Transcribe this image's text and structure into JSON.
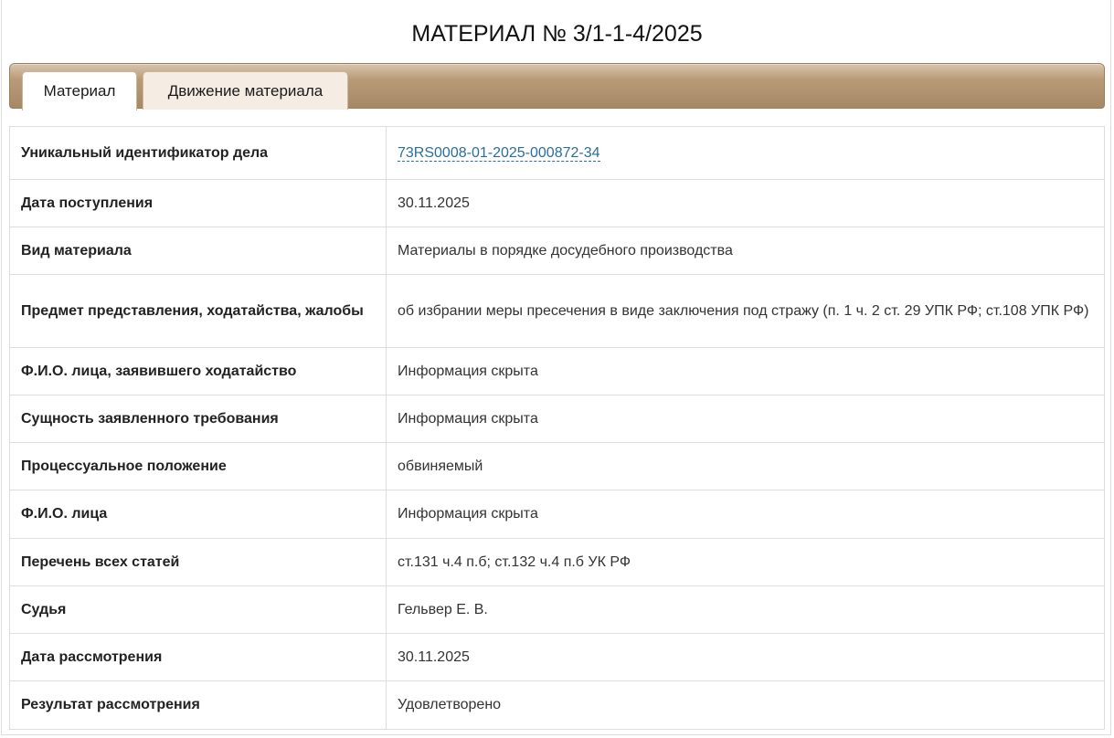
{
  "header": {
    "title": "МАТЕРИАЛ № 3/1-1-4/2025"
  },
  "tabs": [
    {
      "label": "Материал",
      "active": true
    },
    {
      "label": "Движение материала",
      "active": false
    }
  ],
  "rows": [
    {
      "label": "Уникальный идентификатор дела",
      "value": "73RS0008-01-2025-000872-34",
      "link": true
    },
    {
      "label": "Дата поступления",
      "value": "30.11.2025"
    },
    {
      "label": "Вид материала",
      "value": "Материалы в порядке досудебного производства"
    },
    {
      "label": "Предмет представления, ходатайства, жалобы",
      "value": "об избрании меры пресечения в виде заключения под стражу (п. 1 ч. 2 ст. 29 УПК РФ; ст.108 УПК РФ)"
    },
    {
      "label": "Ф.И.О. лица, заявившего ходатайство",
      "value": "Информация скрыта"
    },
    {
      "label": "Сущность заявленного требования",
      "value": "Информация скрыта"
    },
    {
      "label": "Процессуальное положение",
      "value": "обвиняемый"
    },
    {
      "label": "Ф.И.О. лица",
      "value": "Информация скрыта"
    },
    {
      "label": "Перечень всех статей",
      "value": "ст.131 ч.4 п.б; ст.132 ч.4 п.б УК РФ"
    },
    {
      "label": "Судья",
      "value": "Гельвер Е. В."
    },
    {
      "label": "Дата рассмотрения",
      "value": "30.11.2025"
    },
    {
      "label": "Результат рассмотрения",
      "value": "Удовлетворено"
    }
  ],
  "colors": {
    "link": "#2a6e9e",
    "tabbar_top": "#d9c5ad",
    "tabbar_bottom": "#a78866",
    "border": "#dddddd"
  }
}
